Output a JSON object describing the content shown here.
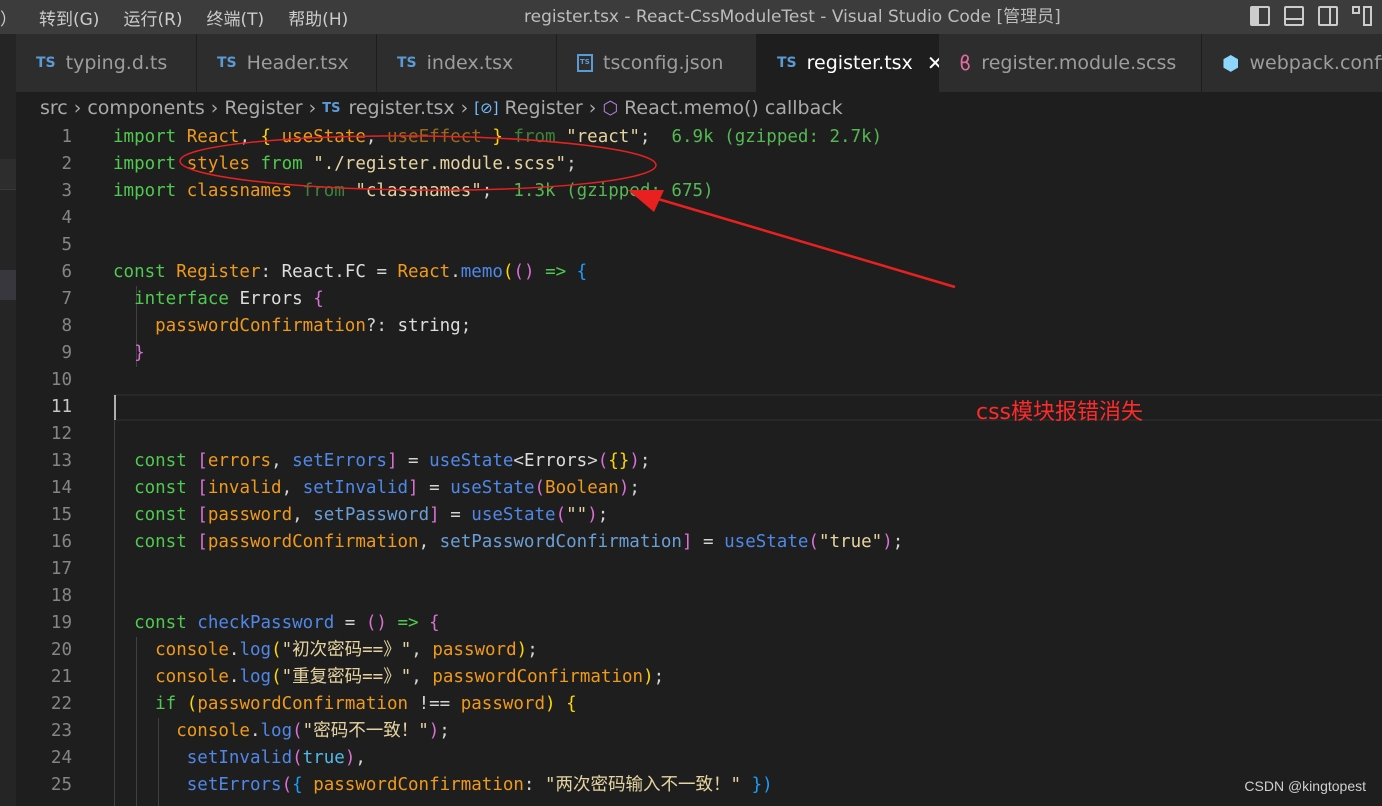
{
  "menu": [
    "）",
    "转到(G)",
    "运行(R)",
    "终端(T)",
    "帮助(H)"
  ],
  "window_title": "register.tsx - React-CssModuleTest - Visual Studio Code [管理员]",
  "tabs": [
    {
      "label": "typing.d.ts",
      "icon": "ts-icon"
    },
    {
      "label": "Header.tsx",
      "icon": "ts-icon"
    },
    {
      "label": "index.tsx",
      "icon": "ts-icon"
    },
    {
      "label": "tsconfig.json",
      "icon": "tsconfig-icon"
    },
    {
      "label": "register.tsx",
      "icon": "ts-icon",
      "active": true
    },
    {
      "label": "register.module.scss",
      "icon": "sass-icon"
    },
    {
      "label": "webpack.config",
      "icon": "webpack-icon"
    }
  ],
  "ts_badge": "TS",
  "breadcrumb": [
    "src",
    "components",
    "Register",
    "register.tsx",
    "Register",
    "React.memo() callback"
  ],
  "line_numbers": [
    "1",
    "2",
    "3",
    "4",
    "5",
    "6",
    "7",
    "8",
    "9",
    "10",
    "11",
    "12",
    "13",
    "14",
    "15",
    "16",
    "17",
    "18",
    "19",
    "20",
    "21",
    "22",
    "23",
    "24",
    "25"
  ],
  "current_line": "11",
  "annotation": "css模块报错消失",
  "watermark": "CSDN @kingtopest"
}
